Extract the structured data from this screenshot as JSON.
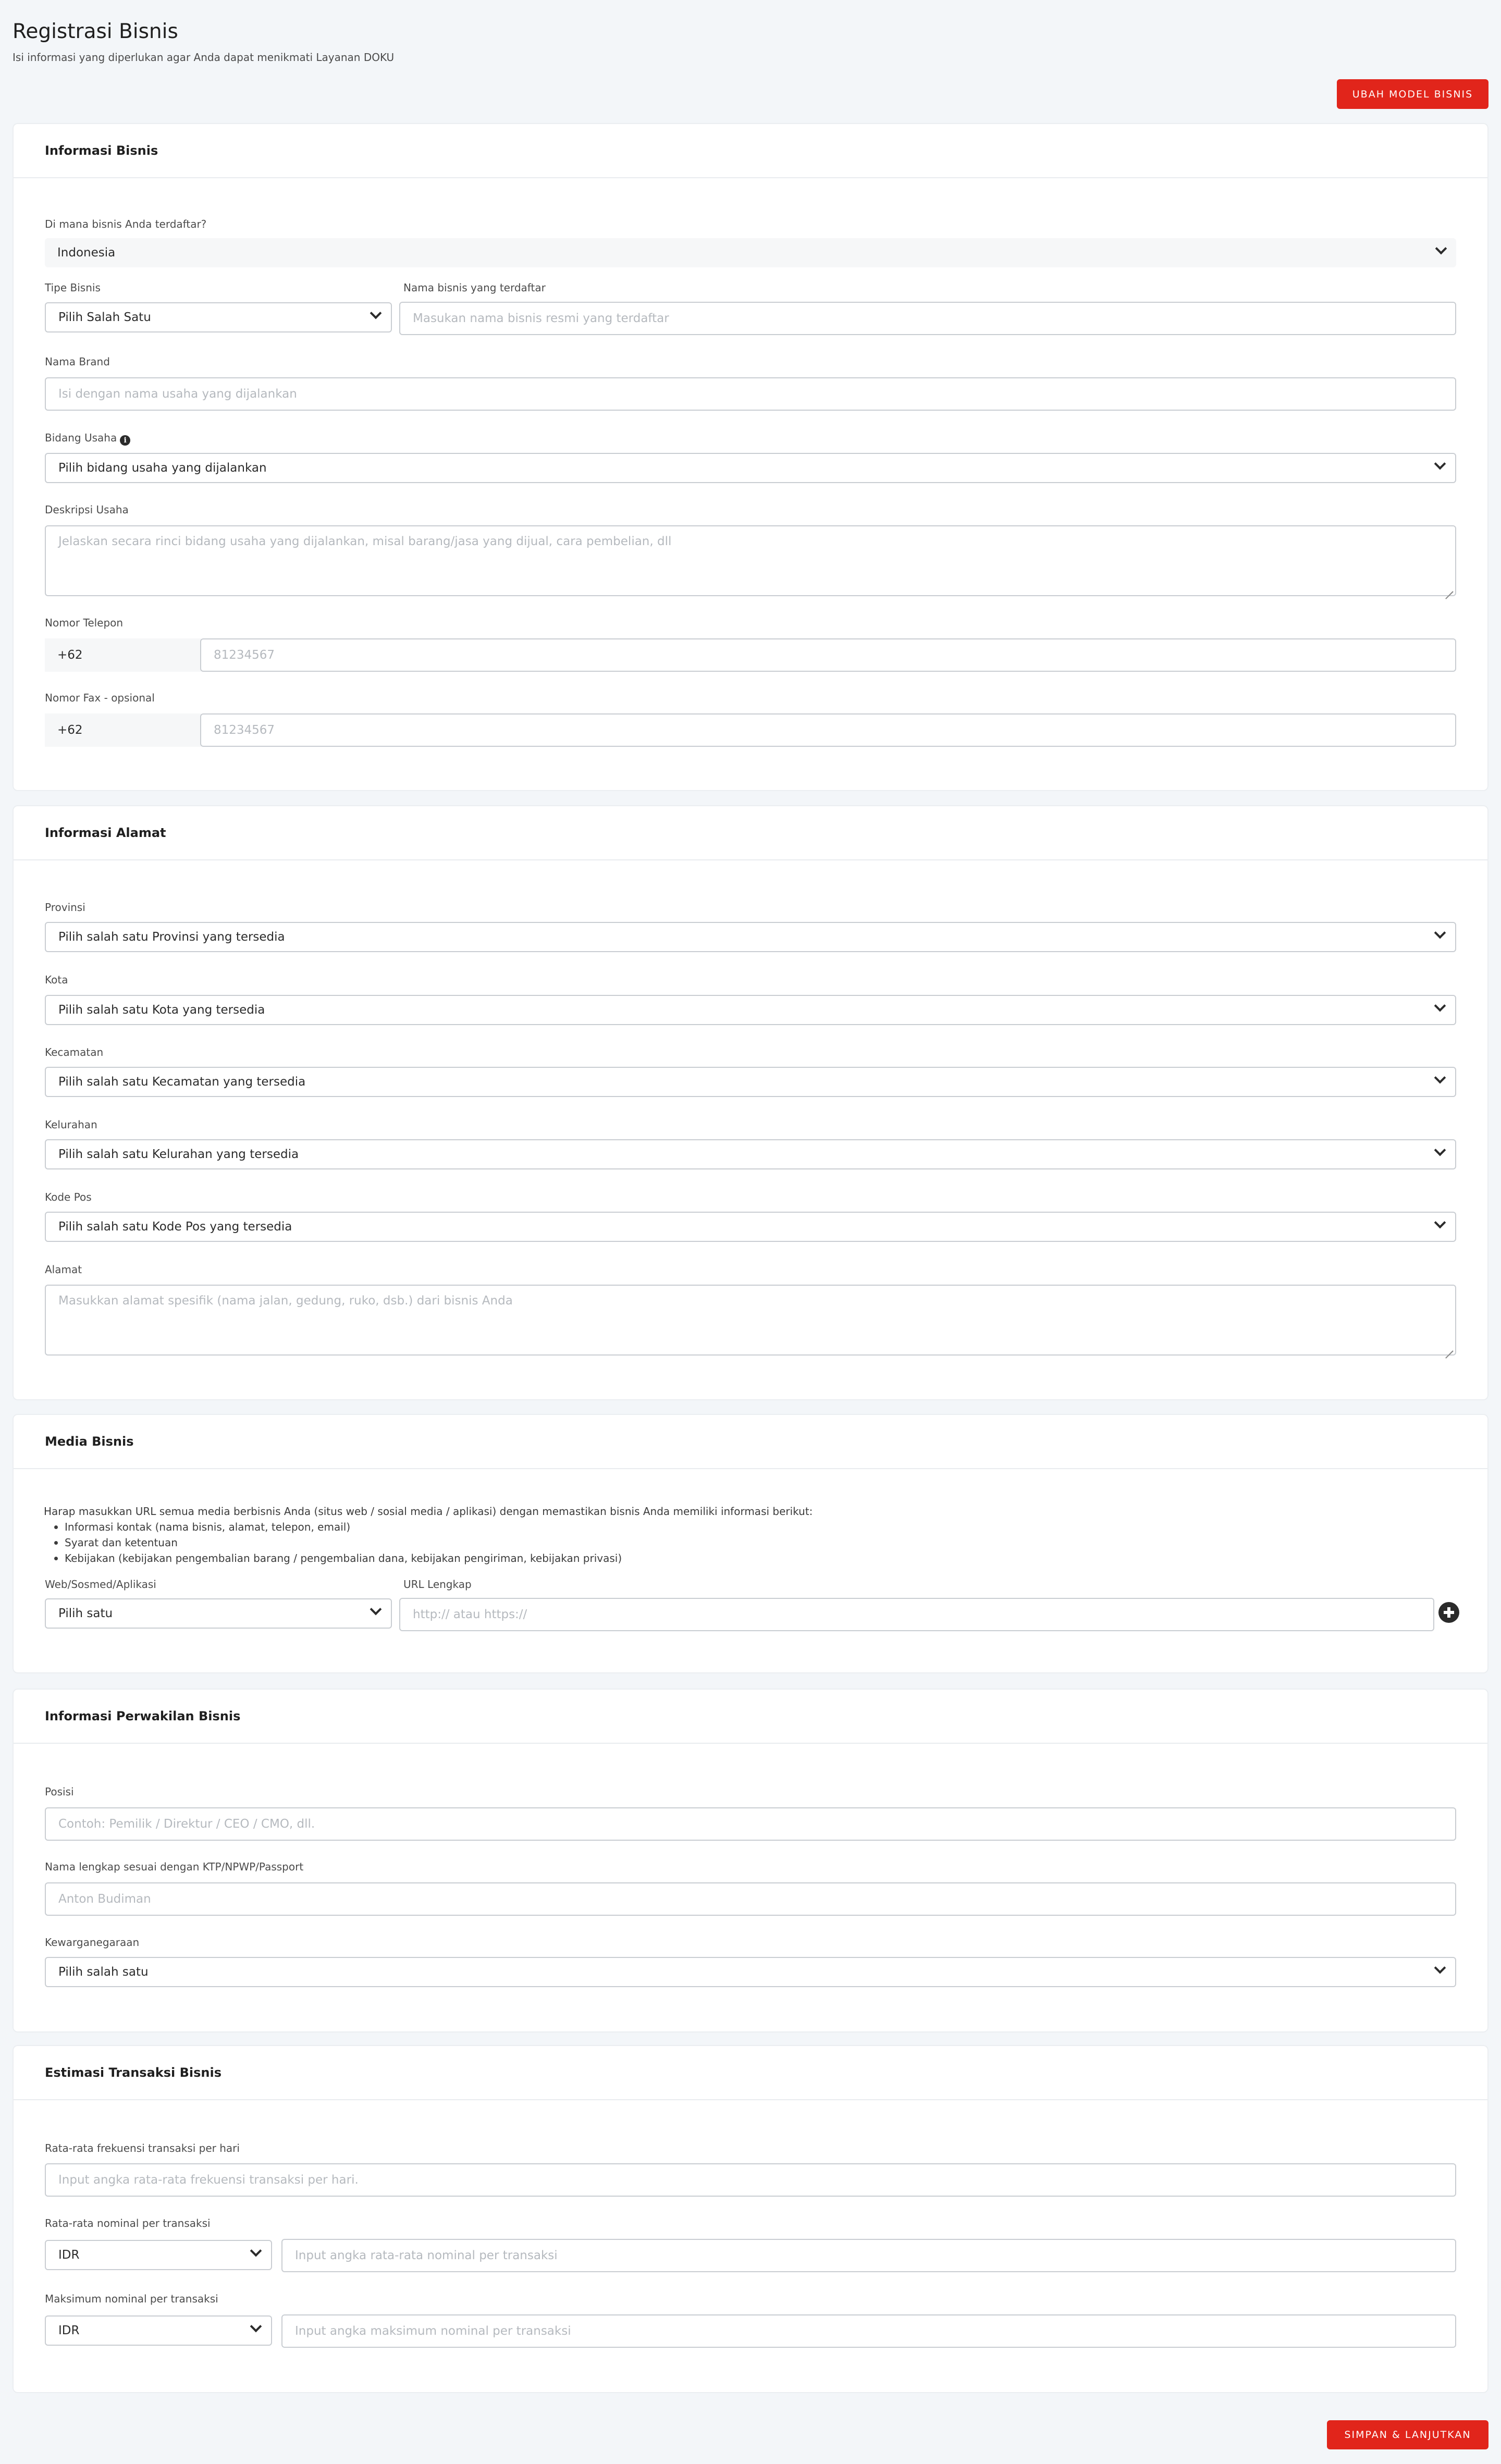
{
  "header": {
    "title": "Registrasi Bisnis",
    "subtitle": "Isi informasi yang diperlukan agar Anda dapat menikmati Layanan DOKU",
    "change_model_button": "UBAH MODEL BISNIS"
  },
  "colors": {
    "accent": "#e1251b",
    "background": "#f3f6f9"
  },
  "info_bisnis": {
    "title": "Informasi Bisnis",
    "country_label": "Di mana bisnis Anda terdaftar?",
    "country_value": "Indonesia",
    "type_label": "Tipe Bisnis",
    "type_value": "Pilih Salah Satu",
    "name_label": "Nama bisnis yang terdaftar",
    "name_placeholder": "Masukan nama bisnis resmi yang terdaftar",
    "brand_label": "Nama Brand",
    "brand_placeholder": "Isi dengan nama usaha yang dijalankan",
    "field_label": "Bidang Usaha",
    "field_value": "Pilih bidang usaha yang dijalankan",
    "desc_label": "Deskripsi Usaha",
    "desc_placeholder": "Jelaskan secara rinci bidang usaha yang dijalankan, misal barang/jasa yang dijual, cara pembelian, dll",
    "phone_label": "Nomor Telepon",
    "phone_prefix": "+62",
    "phone_placeholder": "81234567",
    "fax_label": "Nomor Fax - opsional",
    "fax_prefix": "+62",
    "fax_placeholder": "81234567"
  },
  "info_alamat": {
    "title": "Informasi Alamat",
    "province_label": "Provinsi",
    "province_value": "Pilih salah satu Provinsi yang tersedia",
    "city_label": "Kota",
    "city_value": "Pilih salah satu Kota yang tersedia",
    "district_label": "Kecamatan",
    "district_value": "Pilih salah satu Kecamatan yang tersedia",
    "village_label": "Kelurahan",
    "village_value": "Pilih salah satu Kelurahan yang tersedia",
    "postal_label": "Kode Pos",
    "postal_value": "Pilih salah satu Kode Pos yang tersedia",
    "address_label": "Alamat",
    "address_placeholder": "Masukkan alamat spesifik (nama jalan, gedung, ruko, dsb.) dari bisnis Anda"
  },
  "media_bisnis": {
    "title": "Media Bisnis",
    "intro": "Harap masukkan URL semua media berbisnis Anda (situs web / sosial media / aplikasi) dengan memastikan bisnis Anda memiliki informasi berikut:",
    "items": [
      "Informasi kontak (nama bisnis, alamat, telepon, email)",
      "Syarat dan ketentuan",
      "Kebijakan (kebijakan pengembalian barang / pengembalian dana, kebijakan pengiriman, kebijakan privasi)"
    ],
    "type_label": "Web/Sosmed/Aplikasi",
    "type_value": "Pilih satu",
    "url_label": "URL Lengkap",
    "url_placeholder": "http:// atau https://"
  },
  "perwakilan": {
    "title": "Informasi Perwakilan Bisnis",
    "position_label": "Posisi",
    "position_placeholder": "Contoh: Pemilik / Direktur / CEO / CMO, dll.",
    "fullname_label": "Nama lengkap sesuai dengan KTP/NPWP/Passport",
    "fullname_placeholder": "Anton Budiman",
    "citizenship_label": "Kewarganegaraan",
    "citizenship_value": "Pilih salah satu"
  },
  "estimasi": {
    "title": "Estimasi Transaksi Bisnis",
    "freq_label": "Rata-rata frekuensi transaksi per hari",
    "freq_placeholder": "Input angka rata-rata frekuensi transaksi per hari.",
    "avg_label": "Rata-rata nominal per transaksi",
    "avg_currency": "IDR",
    "avg_placeholder": "Input angka rata-rata nominal per transaksi",
    "max_label": "Maksimum nominal per transaksi",
    "max_currency": "IDR",
    "max_placeholder": "Input angka maksimum nominal per transaksi"
  },
  "footer": {
    "submit_button": "SIMPAN & LANJUTKAN"
  }
}
